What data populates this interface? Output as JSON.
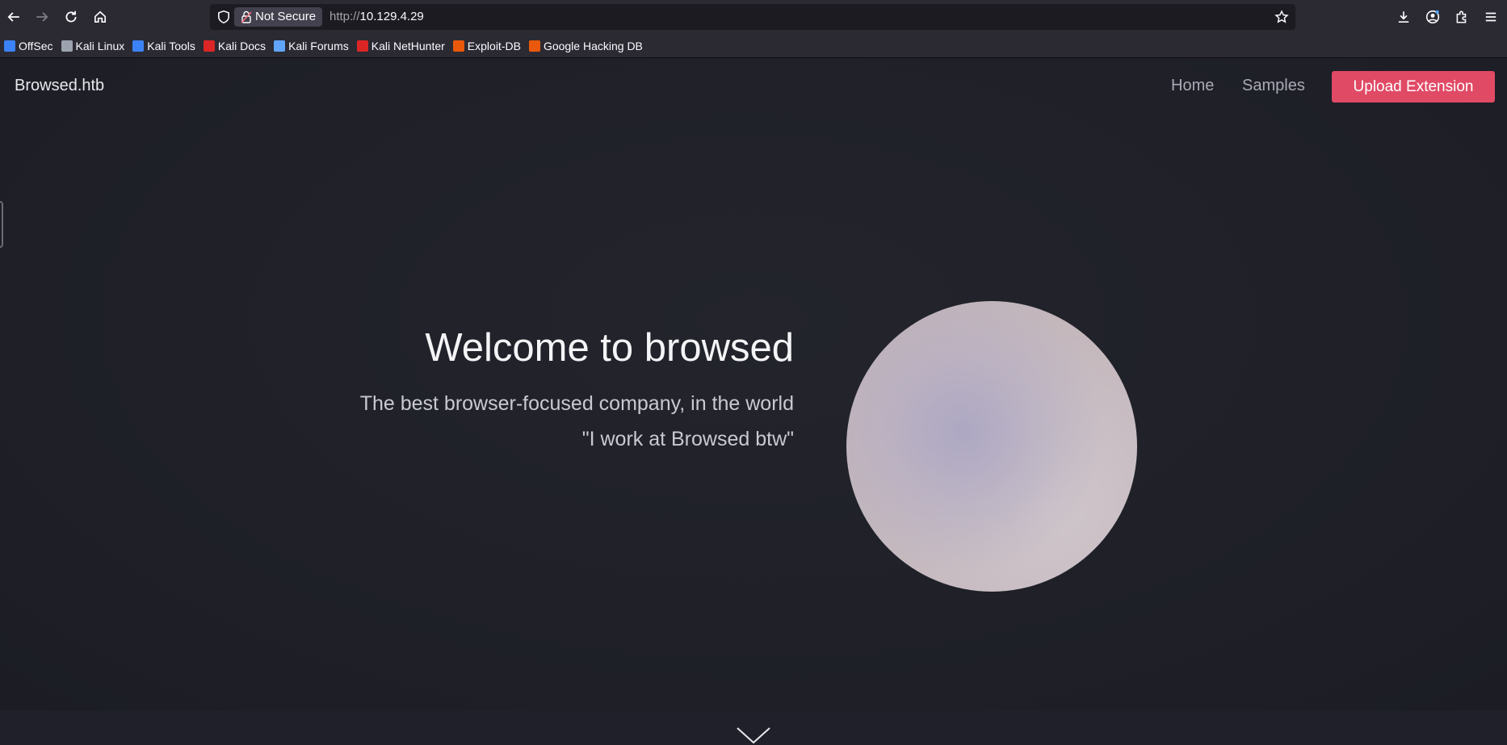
{
  "browser": {
    "not_secure_label": "Not Secure",
    "url_scheme": "http://",
    "url_host": "10.129.4.29",
    "bookmarks": [
      {
        "label": "OffSec",
        "color": "#3b82f6"
      },
      {
        "label": "Kali Linux",
        "color": "#9ca3af"
      },
      {
        "label": "Kali Tools",
        "color": "#3b82f6"
      },
      {
        "label": "Kali Docs",
        "color": "#dc2626"
      },
      {
        "label": "Kali Forums",
        "color": "#60a5fa"
      },
      {
        "label": "Kali NetHunter",
        "color": "#dc2626"
      },
      {
        "label": "Exploit-DB",
        "color": "#ea580c"
      },
      {
        "label": "Google Hacking DB",
        "color": "#ea580c"
      }
    ]
  },
  "site": {
    "brand": "Browsed.htb",
    "nav": {
      "home": "Home",
      "samples": "Samples"
    },
    "upload_button": "Upload Extension",
    "accent_color": "#e04a65"
  },
  "hero": {
    "title": "Welcome to browsed",
    "subtitle": "The best browser-focused company, in the world",
    "quote": "\"I work at Browsed btw\""
  }
}
